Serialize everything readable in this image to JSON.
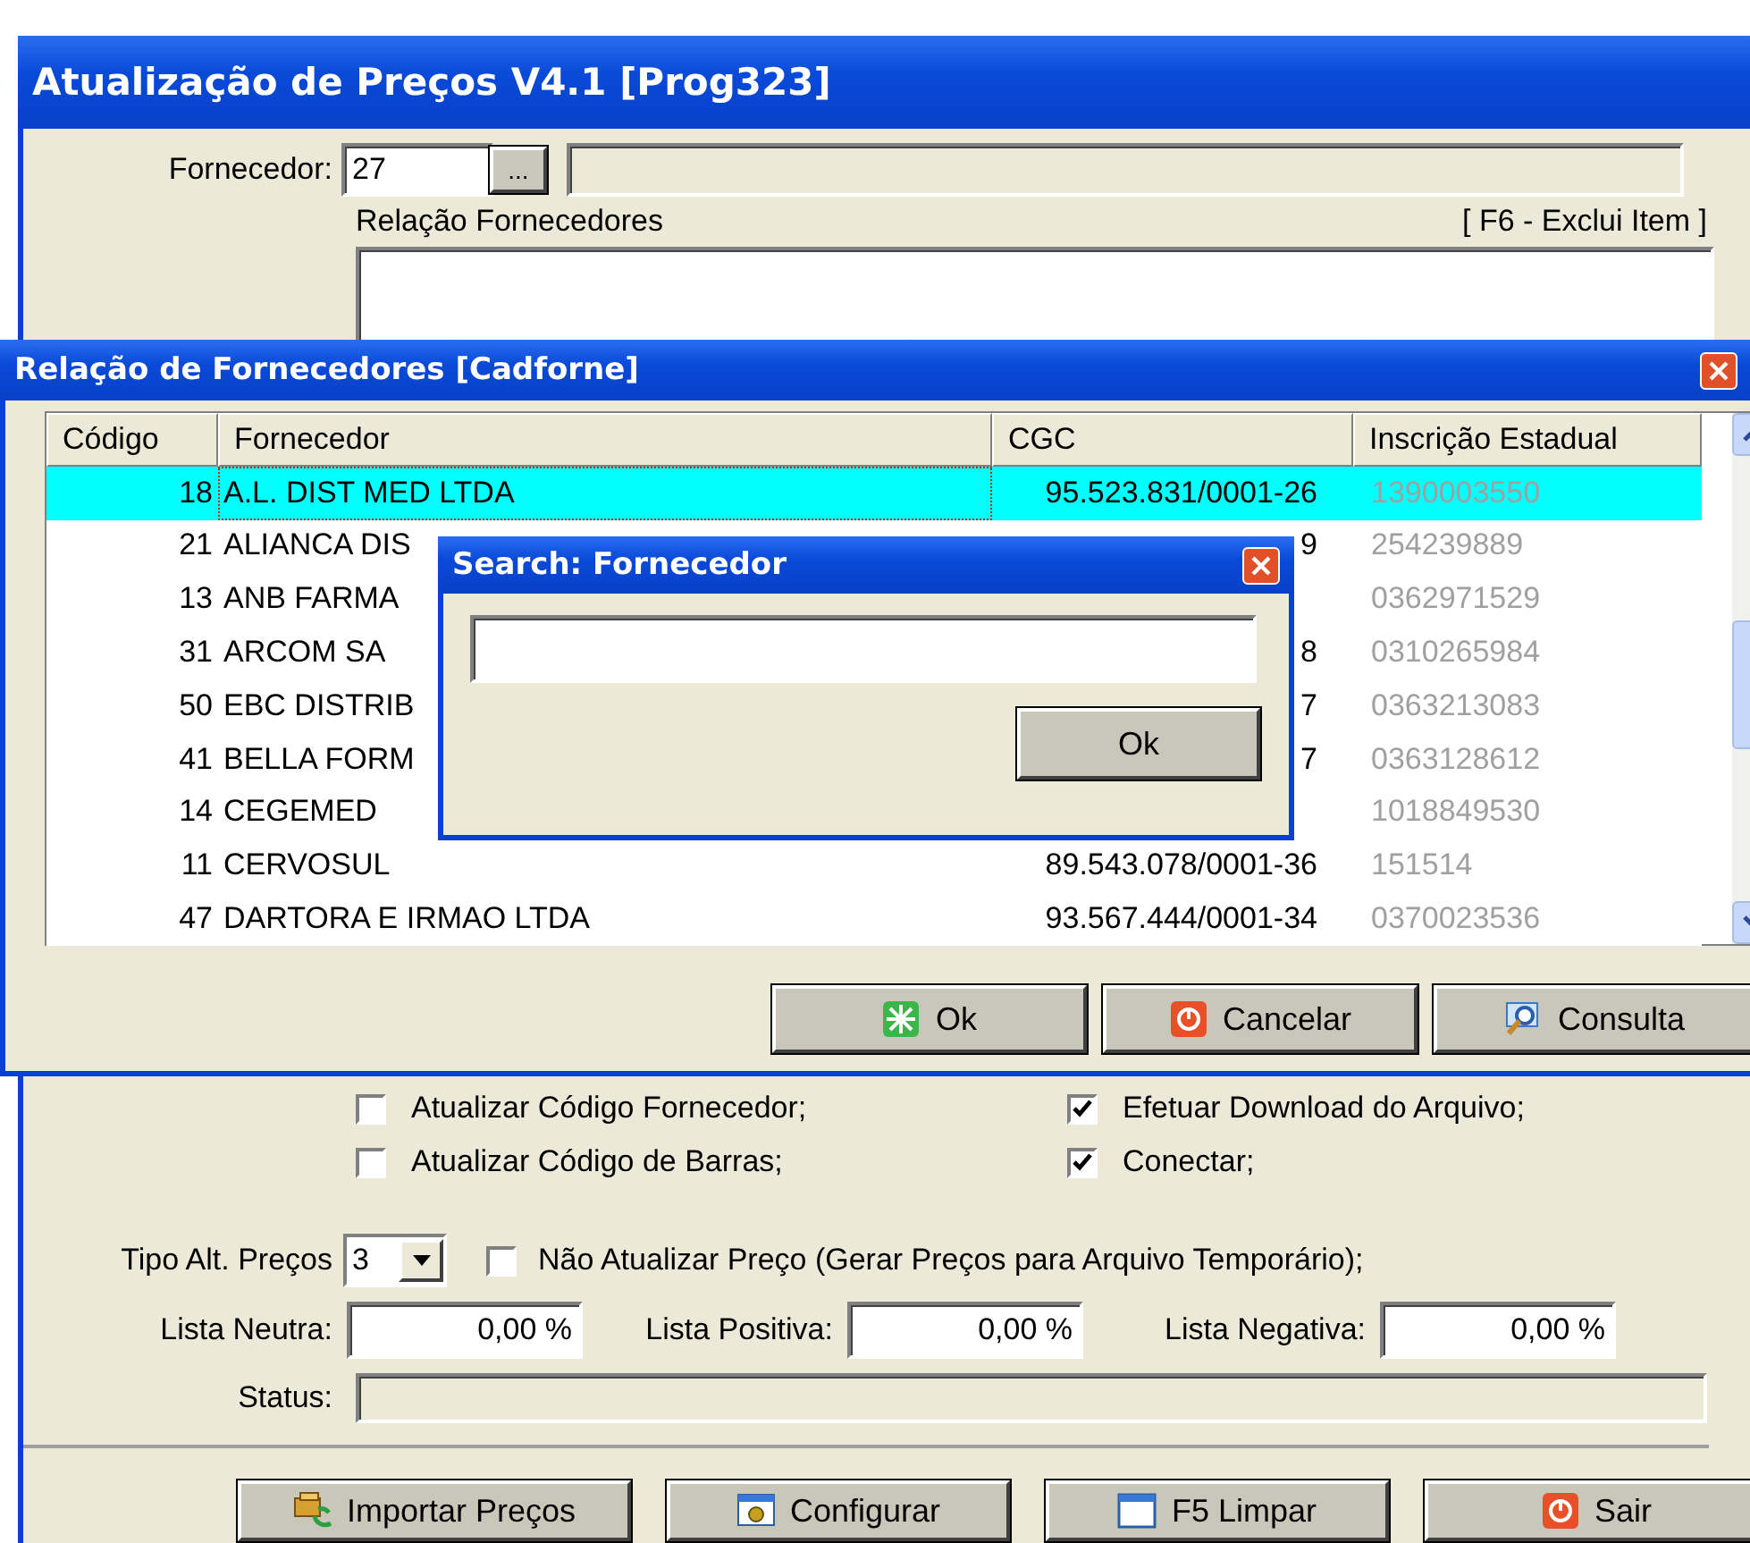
{
  "main_window": {
    "title": "Atualização de Preços V4.1 [Prog323]",
    "supplier_label": "Fornecedor:",
    "supplier_code": "27",
    "lookup_button": "...",
    "list_label": "Relação Fornecedores",
    "list_hint": "[ F6 - Exclui Item ]",
    "options": [
      {
        "label": "Atualizar Código Fornecedor;",
        "checked": false
      },
      {
        "label": "Efetuar Download do Arquivo;",
        "checked": true
      },
      {
        "label": "Atualizar Código de Barras;",
        "checked": false
      },
      {
        "label": "Conectar;",
        "checked": true
      }
    ],
    "price_type": {
      "label": "Tipo Alt. Preços",
      "value": "3"
    },
    "no_update": {
      "label": "Não Atualizar Preço (Gerar Preços para Arquivo Temporário);",
      "checked": false
    },
    "lists": [
      {
        "label": "Lista Neutra:",
        "value": "0,00 %"
      },
      {
        "label": "Lista Positiva:",
        "value": "0,00 %"
      },
      {
        "label": "Lista Negativa:",
        "value": "0,00 %"
      }
    ],
    "status_label": "Status:",
    "buttons": [
      {
        "label": "Importar Preços",
        "kind": "import"
      },
      {
        "label": "Configurar",
        "kind": "config"
      },
      {
        "label": "F5 Limpar",
        "kind": "clear"
      },
      {
        "label": "Sair",
        "kind": "exit"
      }
    ]
  },
  "supplier_dialog": {
    "title": "Relação de Fornecedores [Cadforne]",
    "columns": [
      "Código",
      "Fornecedor",
      "CGC",
      "Inscrição Estadual"
    ],
    "rows": [
      {
        "code": "18",
        "name": "A.L. DIST MED LTDA",
        "cgc": "95.523.831/0001-26",
        "ie": "1390003550",
        "selected": true
      },
      {
        "code": "21",
        "name": "ALIANCA DIS",
        "cgc": "9",
        "ie": "254239889",
        "selected": false
      },
      {
        "code": "13",
        "name": "ANB FARMA",
        "ie": "0362971529",
        "selected": false
      },
      {
        "code": "31",
        "name": "ARCOM SA",
        "cgc": "8",
        "ie": "0310265984",
        "selected": false
      },
      {
        "code": "50",
        "name": "EBC DISTRIB",
        "cgc": "7",
        "ie": "0363213083",
        "selected": false
      },
      {
        "code": "41",
        "name": "BELLA FORM",
        "cgc": "7",
        "ie": "0363128612",
        "selected": false
      },
      {
        "code": "14",
        "name": "CEGEMED",
        "ie": "1018849530",
        "selected": false
      },
      {
        "code": "11",
        "name": "CERVOSUL",
        "cgc": "89.543.078/0001-36",
        "ie": "151514",
        "selected": false
      },
      {
        "code": "47",
        "name": "DARTORA E IRMAO LTDA",
        "cgc": "93.567.444/0001-34",
        "ie": "0370023536",
        "selected": false
      }
    ],
    "buttons": [
      {
        "label": "Ok",
        "kind": "ok"
      },
      {
        "label": "Cancelar",
        "kind": "cancel"
      },
      {
        "label": "Consulta",
        "kind": "search"
      }
    ]
  },
  "search_dialog": {
    "title": "Search: Fornecedor",
    "button": "Ok"
  }
}
